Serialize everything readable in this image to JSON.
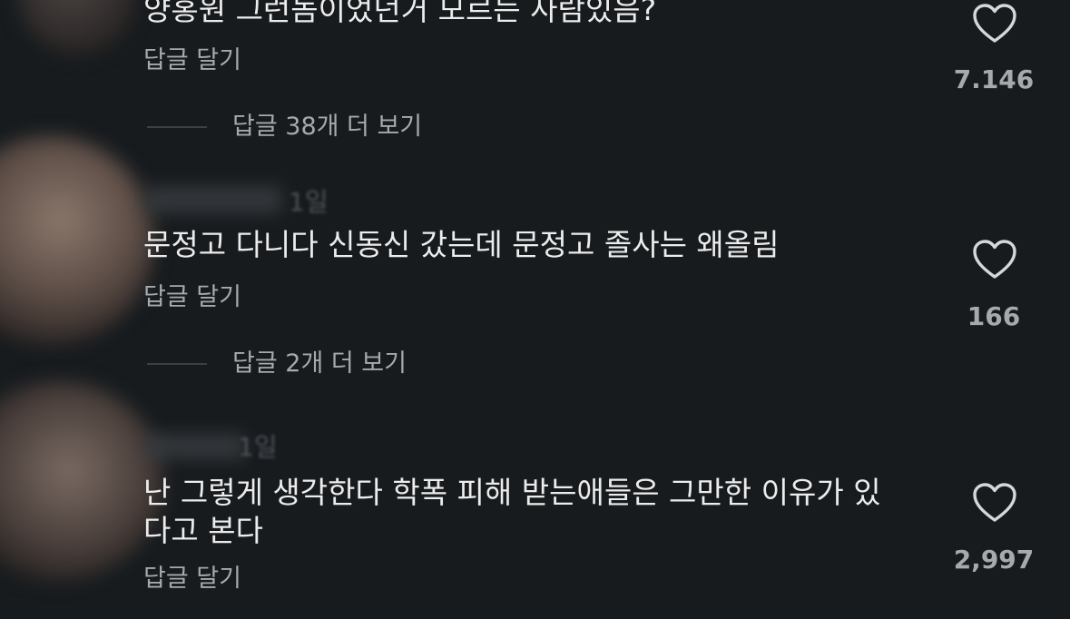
{
  "comments": [
    {
      "text_lines": [
        "양홍원 그런놈이었던거 모르는 사람있음?"
      ],
      "reply_label": "답글 달기",
      "likes": "7.146",
      "more_replies": "답글 38개 더 보기"
    },
    {
      "meta_time": "1일",
      "text_lines": [
        "문정고 다니다 신동신 갔는데 문정고 졸사는 왜올림"
      ],
      "reply_label": "답글 달기",
      "likes": "166",
      "more_replies": "답글 2개 더 보기"
    },
    {
      "meta_time": "1일",
      "text_lines": [
        "난 그렇게 생각한다 학폭 피해 받는애들은 그만한 이유가 있",
        "다고 본다"
      ],
      "reply_label": "답글 달기",
      "likes": "2,997"
    }
  ],
  "icons": {
    "like": "heart-outline-icon"
  },
  "colors": {
    "background": "#171b1e",
    "text": "#ececec",
    "secondary": "#a6a9ad"
  }
}
